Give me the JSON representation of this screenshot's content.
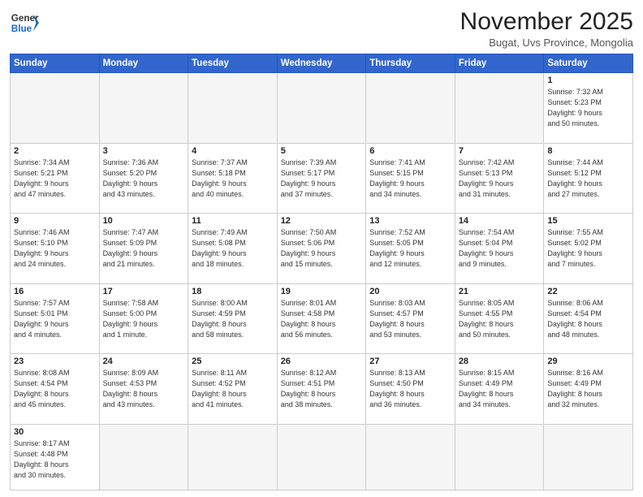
{
  "header": {
    "logo_general": "General",
    "logo_blue": "Blue",
    "title": "November 2025",
    "subtitle": "Bugat, Uvs Province, Mongolia"
  },
  "weekdays": [
    "Sunday",
    "Monday",
    "Tuesday",
    "Wednesday",
    "Thursday",
    "Friday",
    "Saturday"
  ],
  "weeks": [
    [
      {
        "day": "",
        "info": ""
      },
      {
        "day": "",
        "info": ""
      },
      {
        "day": "",
        "info": ""
      },
      {
        "day": "",
        "info": ""
      },
      {
        "day": "",
        "info": ""
      },
      {
        "day": "",
        "info": ""
      },
      {
        "day": "1",
        "info": "Sunrise: 7:32 AM\nSunset: 5:23 PM\nDaylight: 9 hours\nand 50 minutes."
      }
    ],
    [
      {
        "day": "2",
        "info": "Sunrise: 7:34 AM\nSunset: 5:21 PM\nDaylight: 9 hours\nand 47 minutes."
      },
      {
        "day": "3",
        "info": "Sunrise: 7:36 AM\nSunset: 5:20 PM\nDaylight: 9 hours\nand 43 minutes."
      },
      {
        "day": "4",
        "info": "Sunrise: 7:37 AM\nSunset: 5:18 PM\nDaylight: 9 hours\nand 40 minutes."
      },
      {
        "day": "5",
        "info": "Sunrise: 7:39 AM\nSunset: 5:17 PM\nDaylight: 9 hours\nand 37 minutes."
      },
      {
        "day": "6",
        "info": "Sunrise: 7:41 AM\nSunset: 5:15 PM\nDaylight: 9 hours\nand 34 minutes."
      },
      {
        "day": "7",
        "info": "Sunrise: 7:42 AM\nSunset: 5:13 PM\nDaylight: 9 hours\nand 31 minutes."
      },
      {
        "day": "8",
        "info": "Sunrise: 7:44 AM\nSunset: 5:12 PM\nDaylight: 9 hours\nand 27 minutes."
      }
    ],
    [
      {
        "day": "9",
        "info": "Sunrise: 7:46 AM\nSunset: 5:10 PM\nDaylight: 9 hours\nand 24 minutes."
      },
      {
        "day": "10",
        "info": "Sunrise: 7:47 AM\nSunset: 5:09 PM\nDaylight: 9 hours\nand 21 minutes."
      },
      {
        "day": "11",
        "info": "Sunrise: 7:49 AM\nSunset: 5:08 PM\nDaylight: 9 hours\nand 18 minutes."
      },
      {
        "day": "12",
        "info": "Sunrise: 7:50 AM\nSunset: 5:06 PM\nDaylight: 9 hours\nand 15 minutes."
      },
      {
        "day": "13",
        "info": "Sunrise: 7:52 AM\nSunset: 5:05 PM\nDaylight: 9 hours\nand 12 minutes."
      },
      {
        "day": "14",
        "info": "Sunrise: 7:54 AM\nSunset: 5:04 PM\nDaylight: 9 hours\nand 9 minutes."
      },
      {
        "day": "15",
        "info": "Sunrise: 7:55 AM\nSunset: 5:02 PM\nDaylight: 9 hours\nand 7 minutes."
      }
    ],
    [
      {
        "day": "16",
        "info": "Sunrise: 7:57 AM\nSunset: 5:01 PM\nDaylight: 9 hours\nand 4 minutes."
      },
      {
        "day": "17",
        "info": "Sunrise: 7:58 AM\nSunset: 5:00 PM\nDaylight: 9 hours\nand 1 minute."
      },
      {
        "day": "18",
        "info": "Sunrise: 8:00 AM\nSunset: 4:59 PM\nDaylight: 8 hours\nand 58 minutes."
      },
      {
        "day": "19",
        "info": "Sunrise: 8:01 AM\nSunset: 4:58 PM\nDaylight: 8 hours\nand 56 minutes."
      },
      {
        "day": "20",
        "info": "Sunrise: 8:03 AM\nSunset: 4:57 PM\nDaylight: 8 hours\nand 53 minutes."
      },
      {
        "day": "21",
        "info": "Sunrise: 8:05 AM\nSunset: 4:55 PM\nDaylight: 8 hours\nand 50 minutes."
      },
      {
        "day": "22",
        "info": "Sunrise: 8:06 AM\nSunset: 4:54 PM\nDaylight: 8 hours\nand 48 minutes."
      }
    ],
    [
      {
        "day": "23",
        "info": "Sunrise: 8:08 AM\nSunset: 4:54 PM\nDaylight: 8 hours\nand 45 minutes."
      },
      {
        "day": "24",
        "info": "Sunrise: 8:09 AM\nSunset: 4:53 PM\nDaylight: 8 hours\nand 43 minutes."
      },
      {
        "day": "25",
        "info": "Sunrise: 8:11 AM\nSunset: 4:52 PM\nDaylight: 8 hours\nand 41 minutes."
      },
      {
        "day": "26",
        "info": "Sunrise: 8:12 AM\nSunset: 4:51 PM\nDaylight: 8 hours\nand 38 minutes."
      },
      {
        "day": "27",
        "info": "Sunrise: 8:13 AM\nSunset: 4:50 PM\nDaylight: 8 hours\nand 36 minutes."
      },
      {
        "day": "28",
        "info": "Sunrise: 8:15 AM\nSunset: 4:49 PM\nDaylight: 8 hours\nand 34 minutes."
      },
      {
        "day": "29",
        "info": "Sunrise: 8:16 AM\nSunset: 4:49 PM\nDaylight: 8 hours\nand 32 minutes."
      }
    ],
    [
      {
        "day": "30",
        "info": "Sunrise: 8:17 AM\nSunset: 4:48 PM\nDaylight: 8 hours\nand 30 minutes."
      },
      {
        "day": "",
        "info": ""
      },
      {
        "day": "",
        "info": ""
      },
      {
        "day": "",
        "info": ""
      },
      {
        "day": "",
        "info": ""
      },
      {
        "day": "",
        "info": ""
      },
      {
        "day": "",
        "info": ""
      }
    ]
  ]
}
